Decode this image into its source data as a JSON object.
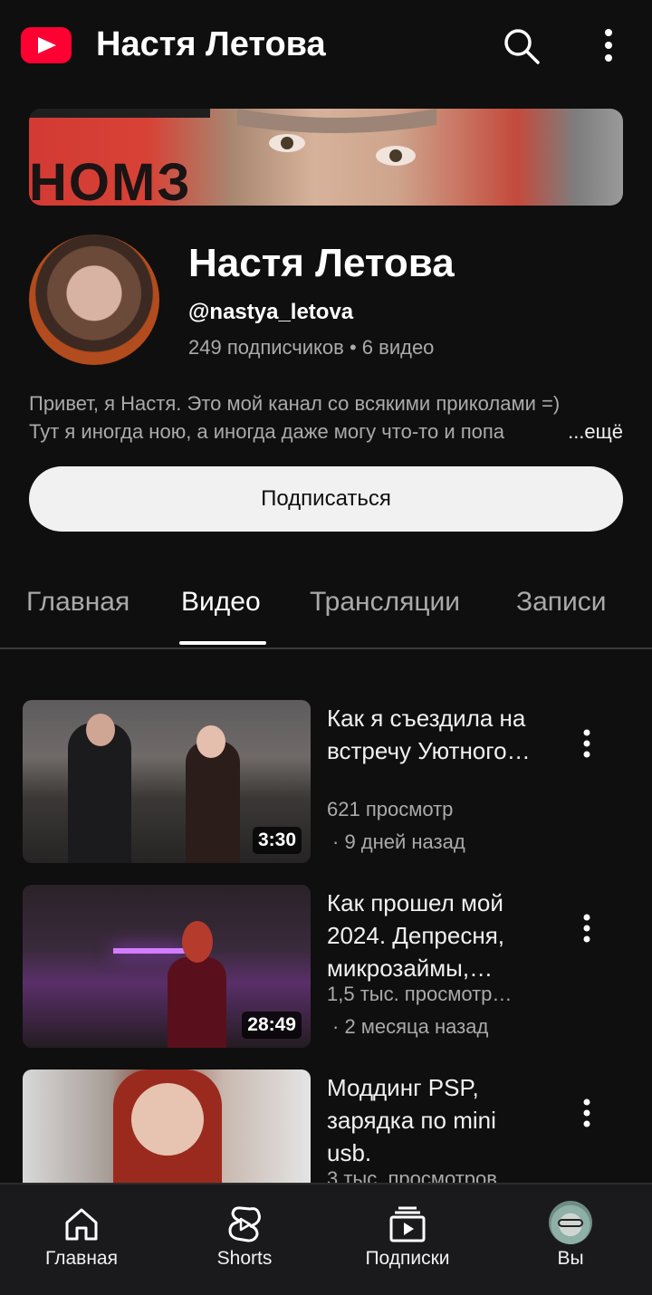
{
  "header": {
    "title": "Настя Летова",
    "icons": [
      "youtube-logo-icon",
      "search-icon",
      "more-vertical-icon"
    ]
  },
  "banner": {
    "text": "НОМЗ"
  },
  "channel": {
    "name": "Настя Летова",
    "handle": "@nastya_letova",
    "subscribers": "249 подписчиков",
    "separator": "•",
    "videos_count": "6 видео",
    "description_line1": "Привет, я Настя. Это мой канал со всякими приколами =)",
    "description_line2": "Тут я иногда ною, а иногда даже могу что-то и попа",
    "more_label": "...ещё",
    "subscribe_label": "Подписаться"
  },
  "tabs": [
    {
      "label": "Главная",
      "active": false
    },
    {
      "label": "Видео",
      "active": true
    },
    {
      "label": "Трансляции",
      "active": false
    },
    {
      "label": "Записи",
      "active": false
    }
  ],
  "videos": [
    {
      "title": "Как я съездила на встречу Уютного…",
      "views": "621 просмотр",
      "date": "· 9 дней назад",
      "duration": "3:30"
    },
    {
      "title": "Как прошел мой 2024. Депресня, микрозаймы,…",
      "views": "1,5 тыс. просмотр…",
      "date": "· 2 месяца назад",
      "duration": "28:49"
    },
    {
      "title": "Моддинг PSP, зарядка по mini usb.",
      "views": "3 тыс. просмотров",
      "date": "",
      "duration": ""
    }
  ],
  "bottom_nav": [
    {
      "label": "Главная",
      "icon": "home-icon"
    },
    {
      "label": "Shorts",
      "icon": "shorts-icon"
    },
    {
      "label": "Подписки",
      "icon": "subscriptions-icon"
    },
    {
      "label": "Вы",
      "icon": "avatar"
    }
  ],
  "colors": {
    "background": "#0f0f0f",
    "brand": "#ff0033",
    "text_secondary": "#aaaaaa",
    "button": "#f1f1f1"
  }
}
